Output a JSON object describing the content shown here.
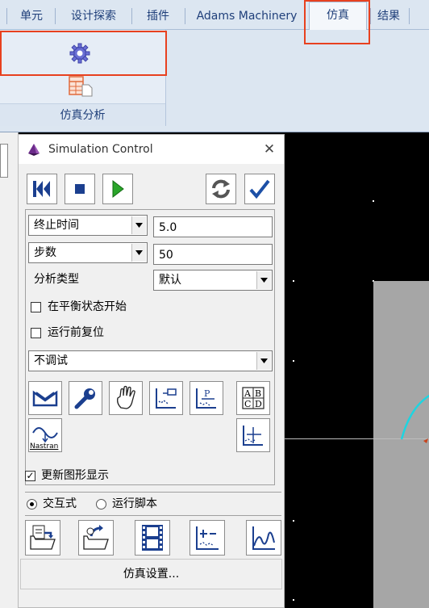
{
  "ribbon": {
    "tabs": [
      {
        "label": "单元"
      },
      {
        "label": "设计探索"
      },
      {
        "label": "插件"
      },
      {
        "label": "Adams Machinery"
      },
      {
        "label": "仿真",
        "active": true
      },
      {
        "label": "结果"
      }
    ],
    "group_label": "仿真分析"
  },
  "dialog": {
    "title": "Simulation Control",
    "end_mode": "终止时间",
    "end_value": "5.0",
    "steps_mode": "步数",
    "steps_value": "50",
    "analysis_type_label": "分析类型",
    "analysis_type_value": "默认",
    "start_equilibrium_label": "在平衡状态开始",
    "start_equilibrium_checked": false,
    "reset_before_run_label": "运行前复位",
    "reset_before_run_checked": false,
    "debug_mode": "不调试",
    "nastran_label": "Nastran",
    "update_graphics_label": "更新图形显示",
    "update_graphics_checked": true,
    "interactive_label": "交互式",
    "run_script_label": "运行脚本",
    "mode_selected": "interactive",
    "sim_settings_label": "仿真设置..."
  },
  "colors": {
    "highlight": "#e8411f",
    "ribbon_bg": "#dce6f1",
    "tab_text": "#1f3f7a",
    "play_green": "#2aa52a",
    "check_blue": "#1c4fa6",
    "curve_cyan": "#1fd4e0"
  }
}
